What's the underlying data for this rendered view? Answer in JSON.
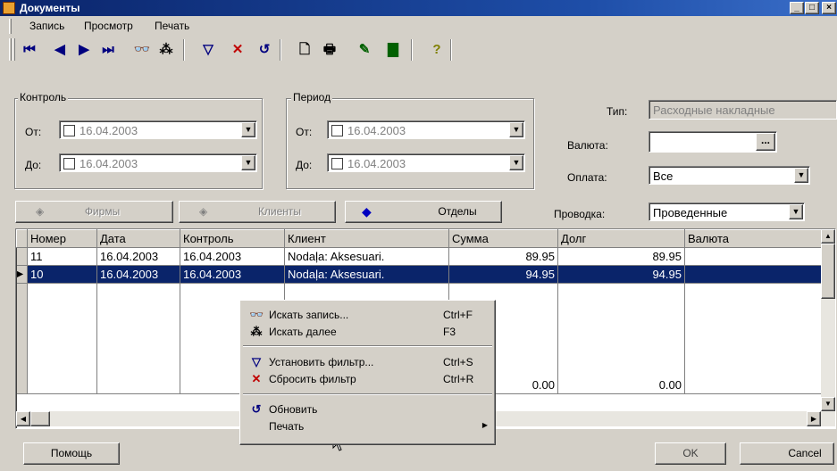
{
  "window": {
    "title": "Документы"
  },
  "menu": [
    "Запись",
    "Просмотр",
    "Печать"
  ],
  "kontrol": {
    "title": "Контроль",
    "from_label": "От:",
    "to_label": "До:",
    "from_value": "16.04.2003",
    "to_value": "16.04.2003"
  },
  "period": {
    "title": "Период",
    "from_label": "От:",
    "to_label": "До:",
    "from_value": "16.04.2003",
    "to_value": "16.04.2003"
  },
  "filters": {
    "tip_label": "Тип:",
    "tip_value": "Расходные накладные",
    "valuta_label": "Валюта:",
    "valuta_value": "",
    "oplata_label": "Оплата:",
    "oplata_value": "Все",
    "provodka_label": "Проводка:",
    "provodka_value": "Проведенные"
  },
  "buttons": {
    "firms": "Фирмы",
    "clients": "Клиенты",
    "depts": "Отделы",
    "help": "Помощь",
    "ok": "OK",
    "cancel": "Cancel",
    "ellipsis": "..."
  },
  "grid": {
    "headers": [
      "Номер",
      "Дата",
      "Контроль",
      "Клиент",
      "Сумма",
      "Долг",
      "Валюта"
    ],
    "rows": [
      [
        "11",
        "16.04.2003",
        "16.04.2003",
        "Nodaļa: Aksesuari.",
        "89.95",
        "89.95",
        ""
      ],
      [
        "10",
        "16.04.2003",
        "16.04.2003",
        "Nodaļa: Aksesuari.",
        "94.95",
        "94.95",
        ""
      ]
    ],
    "totals": {
      "summa": "0.00",
      "dolg": "0.00"
    }
  },
  "context_menu": [
    {
      "label": "Искать запись...",
      "shortcut": "Ctrl+F",
      "icon": "binoculars-icon"
    },
    {
      "label": "Искать далее",
      "shortcut": "F3",
      "icon": "find-next-icon"
    },
    {
      "label": "Установить фильтр...",
      "shortcut": "Ctrl+S",
      "icon": "filter-icon"
    },
    {
      "label": "Сбросить фильтр",
      "shortcut": "Ctrl+R",
      "icon": "clear-filter-icon"
    },
    {
      "label": "Обновить",
      "shortcut": "",
      "icon": "refresh-icon"
    },
    {
      "label": "Печать",
      "shortcut": "",
      "icon": ""
    }
  ],
  "colors": {
    "titlebar": "#0a246a",
    "selection": "#0a246a",
    "face": "#d4d0c8"
  }
}
